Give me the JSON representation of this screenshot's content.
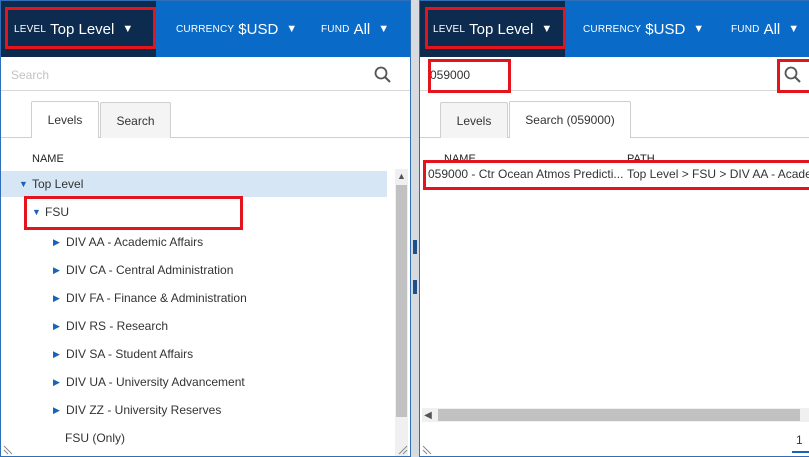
{
  "left": {
    "filters": {
      "level_label": "LEVEL",
      "level_value": "Top Level",
      "currency_label": "CURRENCY",
      "currency_value": "$USD",
      "fund_label": "FUND",
      "fund_value": "All"
    },
    "search": {
      "placeholder": "Search",
      "value": ""
    },
    "tabs": [
      {
        "label": "Levels",
        "active": true
      },
      {
        "label": "Search",
        "active": false
      }
    ],
    "column_name": "NAME",
    "tree": {
      "root": "Top Level",
      "fsu": "FSU",
      "children": [
        "DIV AA - Academic Affairs",
        "DIV CA - Central Administration",
        "DIV FA - Finance & Administration",
        "DIV RS - Research",
        "DIV SA - Student Affairs",
        "DIV UA - University Advancement",
        "DIV ZZ - University Reserves"
      ],
      "fsu_only": "FSU (Only)"
    }
  },
  "right": {
    "filters": {
      "level_label": "LEVEL",
      "level_value": "Top Level",
      "currency_label": "CURRENCY",
      "currency_value": "$USD",
      "fund_label": "FUND",
      "fund_value": "All"
    },
    "search": {
      "placeholder": "",
      "value": "059000"
    },
    "tabs": [
      {
        "label": "Levels",
        "active": false
      },
      {
        "label": "Search (059000)",
        "active": true
      }
    ],
    "columns": {
      "name": "NAME",
      "path": "PATH"
    },
    "results": [
      {
        "name": "059000 - Ctr Ocean Atmos Predicti...",
        "path": "Top Level > FSU > DIV AA - Acade..."
      }
    ],
    "pager": {
      "page": "1"
    }
  },
  "colors": {
    "header_blue": "#0a6ac8",
    "level_dark": "#0d2b4f",
    "highlight_red": "#e3141b",
    "selected_row": "#d6e6f5",
    "tree_triangle": "#1b62b5"
  },
  "icons": [
    "search-icon",
    "caret-down-icon",
    "expand-triangle-icon",
    "collapse-triangle-icon",
    "resize-grip-icon"
  ]
}
